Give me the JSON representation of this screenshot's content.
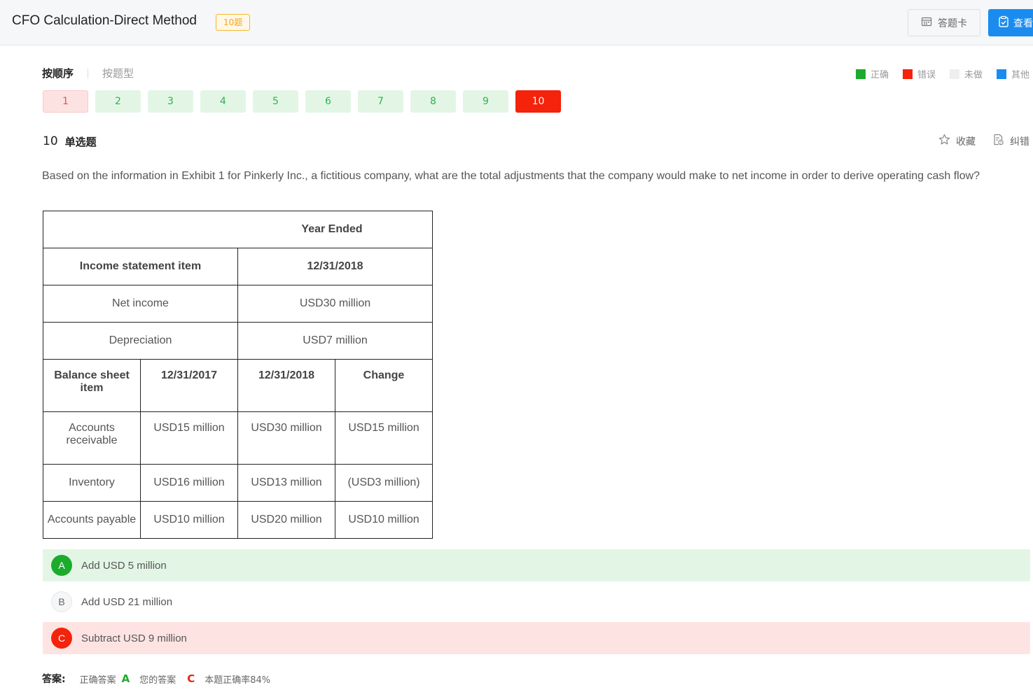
{
  "header": {
    "title": "CFO Calculation-Direct Method",
    "count_badge": "10题",
    "card_button": "答题卡",
    "view_button": "查看"
  },
  "tabs": {
    "active": "按顺序",
    "inactive": "按题型"
  },
  "legend": [
    {
      "label": "正确",
      "color": "#1cab2c"
    },
    {
      "label": "错误",
      "color": "#f5220c"
    },
    {
      "label": "未做",
      "color": "#eeeeee"
    },
    {
      "label": "其他",
      "color": "#1a8cf0"
    }
  ],
  "question_numbers": [
    {
      "label": "1",
      "status": "wrong"
    },
    {
      "label": "2",
      "status": "correct"
    },
    {
      "label": "3",
      "status": "correct"
    },
    {
      "label": "4",
      "status": "correct"
    },
    {
      "label": "5",
      "status": "correct"
    },
    {
      "label": "6",
      "status": "correct"
    },
    {
      "label": "7",
      "status": "correct"
    },
    {
      "label": "8",
      "status": "correct"
    },
    {
      "label": "9",
      "status": "correct"
    },
    {
      "label": "10",
      "status": "current"
    }
  ],
  "question": {
    "number": "10",
    "type": "单选题",
    "favorite_label": "收藏",
    "report_label": "纠错",
    "text": "Based on the information in Exhibit 1 for Pinkerly Inc., a fictitious company, what are the total adjustments that the company would make to net income in order to derive operating cash flow?"
  },
  "exhibit": {
    "year_ended": "Year Ended",
    "income_item_header": "Income statement item",
    "income_date_header": "12/31/2018",
    "income_rows": [
      {
        "item": "Net income",
        "value": "USD30 million"
      },
      {
        "item": "Depreciation",
        "value": "USD7 million"
      }
    ],
    "balance_headers": [
      "Balance sheet item",
      "12/31/2017",
      "12/31/2018",
      "Change"
    ],
    "balance_rows": [
      [
        "Accounts receivable",
        "USD15 million",
        "USD30 million",
        "USD15 million"
      ],
      [
        "Inventory",
        "USD16 million",
        "USD13 million",
        "(USD3 million)"
      ],
      [
        "Accounts payable",
        "USD10 million",
        "USD20 million",
        "USD10 million"
      ]
    ]
  },
  "options": [
    {
      "letter": "A",
      "text": "Add USD 5 million",
      "state": "correct"
    },
    {
      "letter": "B",
      "text": "Add USD 21 million",
      "state": "none"
    },
    {
      "letter": "C",
      "text": "Subtract USD 9 million",
      "state": "wrong"
    }
  ],
  "answer": {
    "label": "答案:",
    "correct_label": "正确答案",
    "correct_value": "A",
    "yours_label": "您的答案",
    "yours_value": "C",
    "rate_text": "本题正确率84%"
  }
}
